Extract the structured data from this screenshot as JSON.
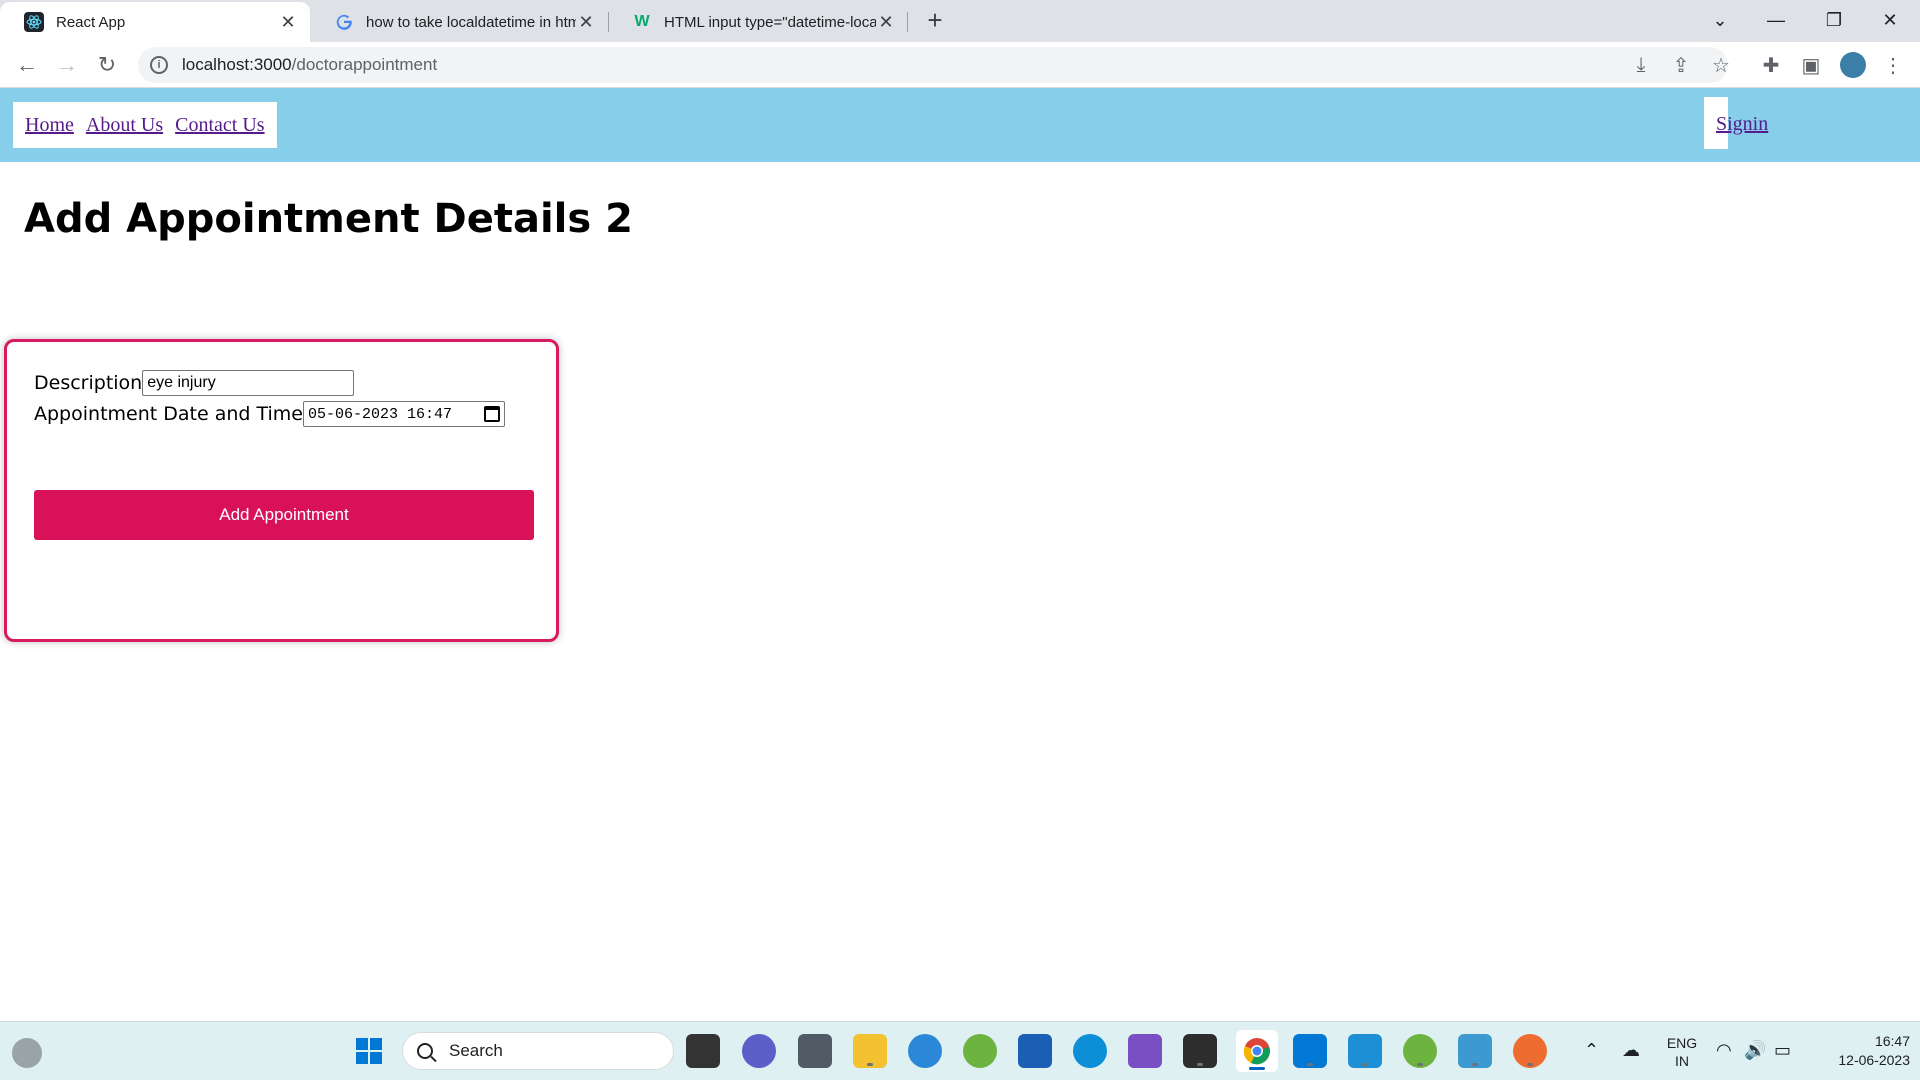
{
  "browser": {
    "tabs": [
      {
        "title": "React App",
        "favicon": "react-icon"
      },
      {
        "title": "how to take localdatetime in htm",
        "favicon": "google-icon"
      },
      {
        "title": "HTML input type=\"datetime-loca",
        "favicon": "w3schools-icon"
      }
    ],
    "url_host": "localhost:3000",
    "url_path": "/doctorappointment"
  },
  "navbar": {
    "links": [
      "Home",
      "About Us",
      "Contact Us"
    ],
    "signin": "Signin",
    "bg_color": "#87ceeb"
  },
  "page": {
    "heading": "Add Appointment Details 2"
  },
  "form": {
    "description_label": "Description",
    "description_value": "eye injury",
    "datetime_label": "Appointment Date and Time",
    "datetime_value": "05-06-2023 16:47",
    "submit_label": "Add Appointment",
    "accent_color": "#d81159"
  },
  "taskbar": {
    "search_placeholder": "Search",
    "language_line1": "ENG",
    "language_line2": "IN",
    "time": "16:47",
    "date": "12-06-2023"
  }
}
